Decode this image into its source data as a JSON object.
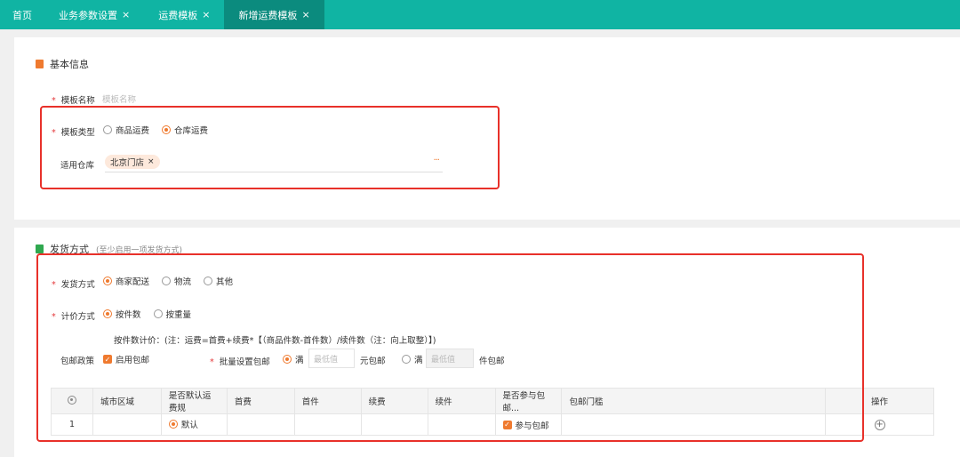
{
  "tabs": [
    {
      "label": "首页",
      "closable": false,
      "active": false
    },
    {
      "label": "业务参数设置",
      "closable": true,
      "active": false
    },
    {
      "label": "运费模板",
      "closable": true,
      "active": false
    },
    {
      "label": "新增运费模板",
      "closable": true,
      "active": true
    }
  ],
  "close_glyph": "×",
  "colors": {
    "primary": "#10b4a3",
    "active_tab": "#0b8b7e",
    "accent": "#ef7a2f",
    "required": "#e4393c",
    "highlight": "#e8312a"
  },
  "basic": {
    "title": "基本信息",
    "icon": "document-icon",
    "template_name_label": "模板名称",
    "template_name_placeholder": "模板名称",
    "template_type_label": "模板类型",
    "template_type_options": [
      {
        "label": "商品运费",
        "selected": false
      },
      {
        "label": "仓库运费",
        "selected": true
      }
    ],
    "warehouse_label": "适用仓库",
    "warehouse_tag": "北京门店",
    "more_glyph": "···"
  },
  "shipping": {
    "title": "发货方式",
    "note": "(至少启用一项发货方式)",
    "icon": "truck-icon",
    "method_label": "发货方式",
    "method_options": [
      {
        "label": "商家配送",
        "selected": true
      },
      {
        "label": "物流",
        "selected": false
      },
      {
        "label": "其他",
        "selected": false
      }
    ],
    "pricing_label": "计价方式",
    "pricing_options": [
      {
        "label": "按件数",
        "selected": true
      },
      {
        "label": "按重量",
        "selected": false
      }
    ],
    "formula": "按件数计价：(注：运费=首费+续费*【（商品件数-首件数）/续件数（注：向上取整）】)",
    "free_policy_label": "包邮政策",
    "enable_free_label": "启用包邮",
    "enable_free_checked": true,
    "batch_label": "批量设置包邮",
    "full_label": "满",
    "min_placeholder": "最低值",
    "yuan_suffix": "元包邮",
    "full_label_2": "满",
    "min_placeholder_2": "最低值",
    "piece_suffix": "件包邮"
  },
  "table": {
    "headers": [
      "城市区域",
      "是否默认运费规",
      "首费",
      "首件",
      "续费",
      "续件",
      "是否参与包邮...",
      "包邮门槛",
      "操作"
    ],
    "rows": [
      {
        "index": "1",
        "default_label": "默认",
        "join_label": "参与包邮"
      }
    ]
  }
}
